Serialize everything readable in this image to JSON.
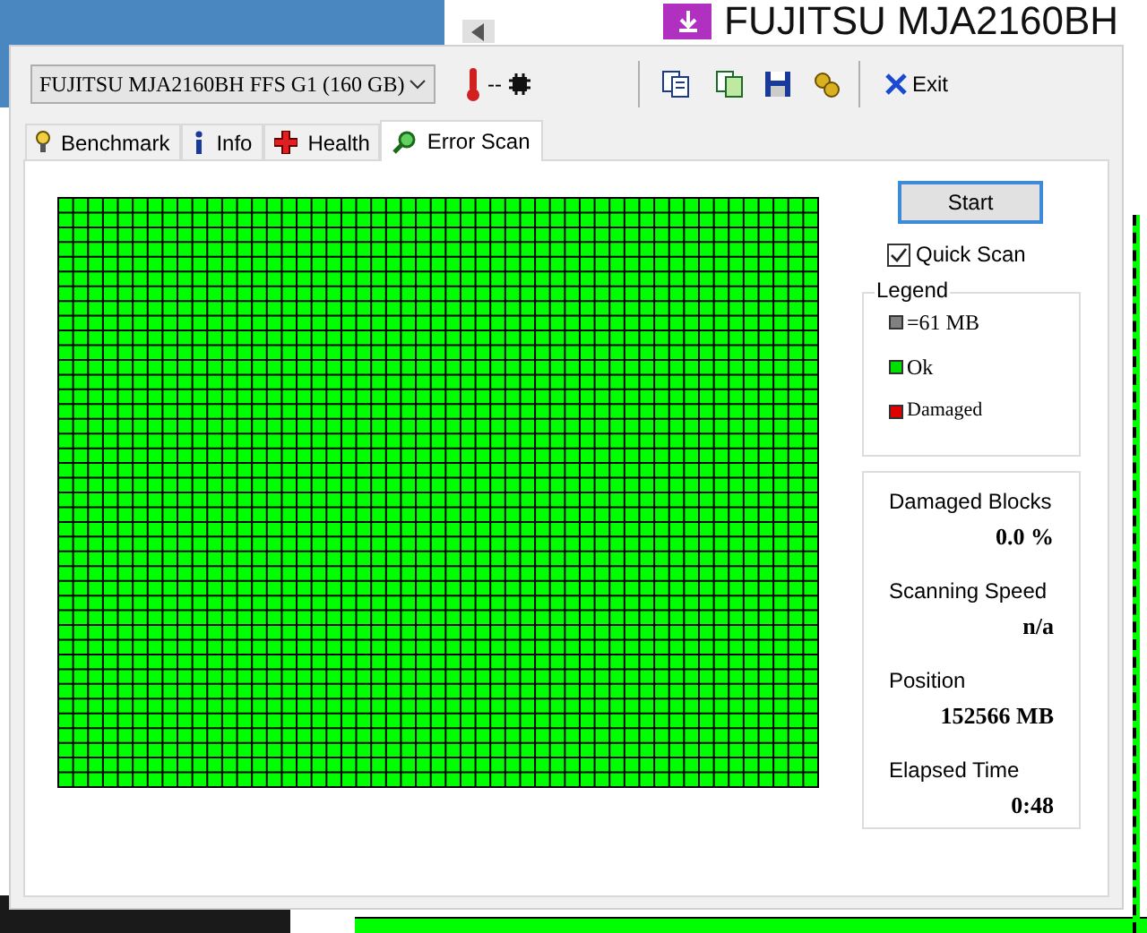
{
  "background_window": {
    "title": "FUJITSU MJA2160BH"
  },
  "device": {
    "name": "FUJITSU MJA2160BH FFS G1 (160 GB)"
  },
  "temperature": "--",
  "toolbar": {
    "exit_label": "Exit"
  },
  "tabs": [
    {
      "label": "Benchmark",
      "kind": "benchmark",
      "selected": false
    },
    {
      "label": "Info",
      "kind": "info",
      "selected": false
    },
    {
      "label": "Health",
      "kind": "health",
      "selected": false
    },
    {
      "label": "Error Scan",
      "kind": "scan",
      "selected": true
    }
  ],
  "start_button": {
    "label": "Start"
  },
  "quick_scan": {
    "label": "Quick Scan",
    "checked": true
  },
  "legend": {
    "title": "Legend",
    "items": [
      {
        "label": "=61 MB",
        "color": "#808080"
      },
      {
        "label": "Ok",
        "color": "#00e000"
      },
      {
        "label": "Damaged",
        "color": "#e00000"
      }
    ]
  },
  "stats": [
    {
      "label": "Damaged Blocks",
      "value": "0.0 %"
    },
    {
      "label": "Scanning Speed",
      "value": "n/a"
    },
    {
      "label": "Position",
      "value": "152566 MB"
    },
    {
      "label": "Elapsed Time",
      "value": "0:48"
    }
  ]
}
